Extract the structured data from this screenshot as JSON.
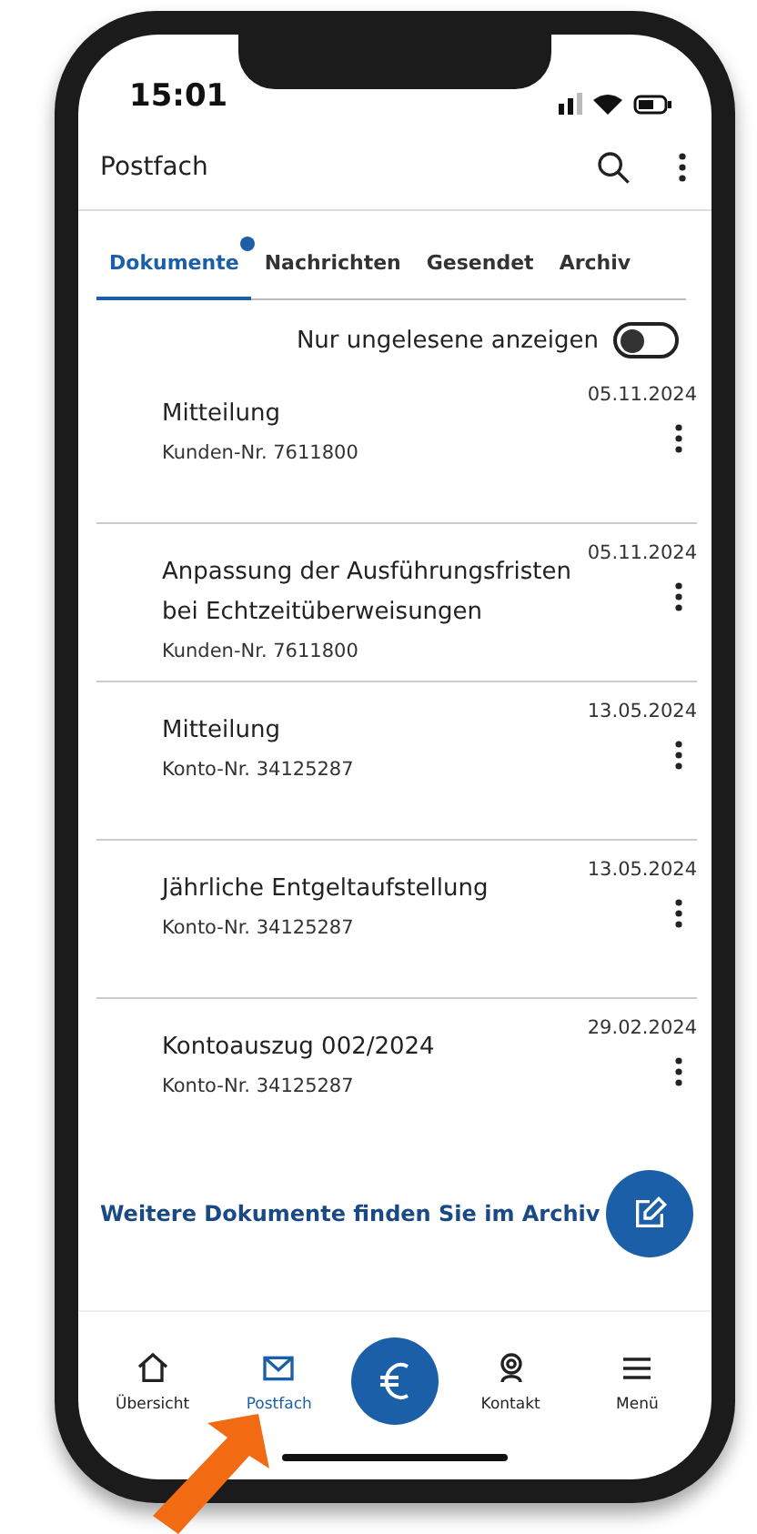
{
  "status_bar": {
    "time": "15:01"
  },
  "header": {
    "title": "Postfach"
  },
  "tabs": [
    {
      "label": "Dokumente",
      "selected": true,
      "badge": true
    },
    {
      "label": "Nachrichten",
      "selected": false,
      "badge": false
    },
    {
      "label": "Gesendet",
      "selected": false,
      "badge": false
    },
    {
      "label": "Archiv",
      "selected": false,
      "badge": false
    }
  ],
  "filter": {
    "label": "Nur ungelesene anzeigen",
    "on": false
  },
  "documents": [
    {
      "title": "Mitteilung",
      "subtitle": "Kunden-Nr. 7611800",
      "date": "05.11.2024"
    },
    {
      "title": "Anpassung der Ausführungsfristen bei Echtzeitüberweisungen",
      "subtitle": "Kunden-Nr. 7611800",
      "date": "05.11.2024"
    },
    {
      "title": "Mitteilung",
      "subtitle": "Konto-Nr. 34125287",
      "date": "13.05.2024"
    },
    {
      "title": "Jährliche Entgeltaufstellung",
      "subtitle": "Konto-Nr. 34125287",
      "date": "13.05.2024"
    },
    {
      "title": "Kontoauszug 002/2024",
      "subtitle": "Konto-Nr. 34125287",
      "date": "29.02.2024"
    }
  ],
  "archive_link": "Weitere Dokumente finden Sie im Archiv",
  "bottom_nav": [
    {
      "kind": "home",
      "label": "Übersicht",
      "selected": false
    },
    {
      "kind": "mail",
      "label": "Postfach",
      "selected": true
    },
    {
      "kind": "euro",
      "selected": false
    },
    {
      "kind": "contact",
      "label": "Kontakt",
      "selected": false
    },
    {
      "kind": "menu",
      "label": "Menü",
      "selected": false
    }
  ]
}
